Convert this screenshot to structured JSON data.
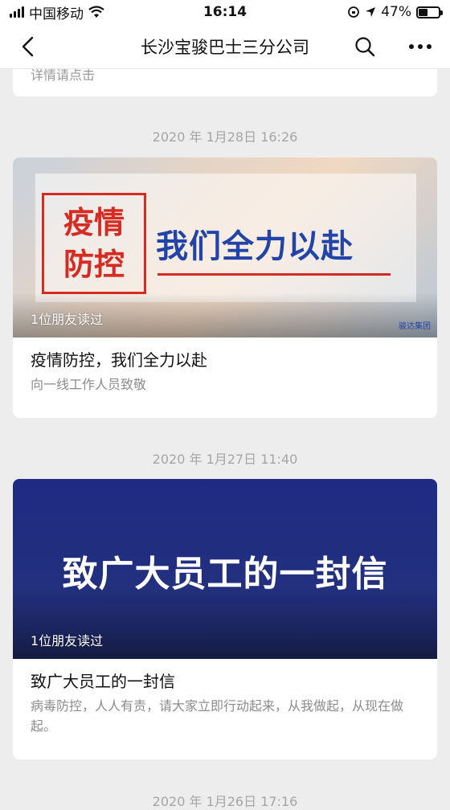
{
  "status": {
    "carrier": "中国移动",
    "time": "16:14",
    "battery_text": "47%",
    "battery_level": 0.47
  },
  "nav": {
    "title": "长沙宝骏巴士三分公司"
  },
  "top_card": {
    "partial_text": "详情请点击"
  },
  "articles": [
    {
      "time": "2020 年 1月28日 16:26",
      "cover": {
        "stamp_line1": "疫情",
        "stamp_line2": "防控",
        "slogan": "我们全力以赴",
        "logo_text": "骏达集团"
      },
      "friends_read": "1位朋友读过",
      "title": "疫情防控，我们全力以赴",
      "desc": "向一线工作人员致敬"
    },
    {
      "time": "2020 年 1月27日 11:40",
      "cover": {
        "headline": "致广大员工的一封信"
      },
      "friends_read": "1位朋友读过",
      "title": "致广大员工的一封信",
      "desc": "病毒防控，人人有责，请大家立即行动起来，从我做起，从现在做起。"
    }
  ],
  "next_time": "2020 年 1月26日 17:16",
  "colors": {
    "accent_red": "#d62b22",
    "slogan_blue": "#2244a8",
    "letter_bg": "#1f2b82"
  }
}
